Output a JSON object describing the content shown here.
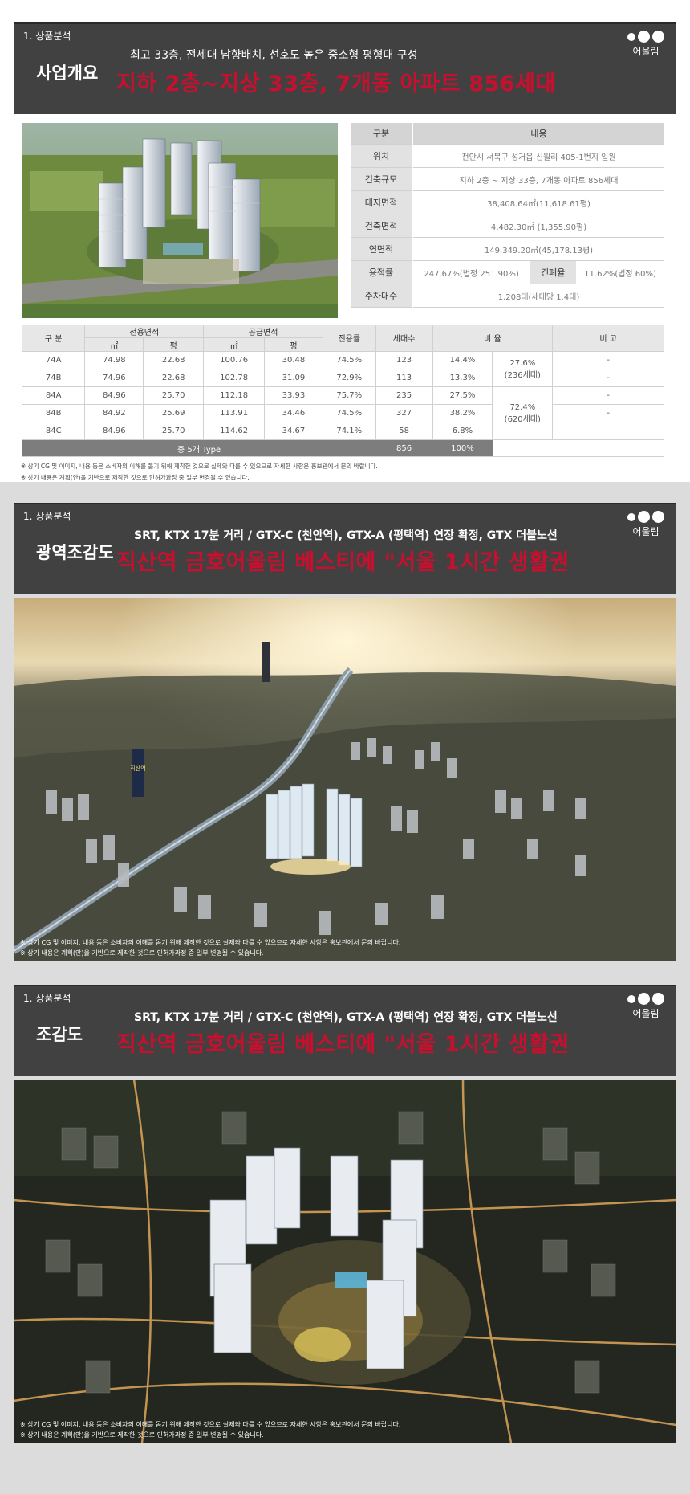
{
  "logo": {
    "label": "어울림"
  },
  "section1": {
    "crumb": "1. 상품분석",
    "title": "사업개요",
    "subtitle": "최고 33층, 전세대 남향배치, 선호도 높은 중소형 평형대 구성",
    "headline": "지하 2층~지상 33층, 7개동 아파트 856세대",
    "spec": {
      "head_key": "구분",
      "head_val": "내용",
      "rows": [
        {
          "k": "위치",
          "v": "천안시 서북구 성거읍 신월리 405-1번지 일원"
        },
        {
          "k": "건축규모",
          "v": "지하 2층 ~ 지상 33층, 7개동 아파트 856세대"
        },
        {
          "k": "대지면적",
          "v": "38,408.64㎡(11,618.61평)"
        },
        {
          "k": "건축면적",
          "v": "4,482.30㎡ (1,355.90평)"
        },
        {
          "k": "연면적",
          "v": "149,349.20㎡(45,178.13평)"
        }
      ],
      "far_key": "용적률",
      "far_val": "247.67%(법정 251.90%)",
      "bcr_key": "건폐율",
      "bcr_val": "11.62%(법정 60%)",
      "parking_key": "주차대수",
      "parking_val": "1,208대(세대당 1.4대)"
    },
    "units": {
      "h_type": "구 분",
      "h_exclusive": "전용면적",
      "h_supply": "공급면적",
      "h_m2": "㎡",
      "h_py": "평",
      "h_rate": "전용률",
      "h_households": "세대수",
      "h_ratio": "비 율",
      "h_note": "비 고",
      "rows": [
        {
          "type": "74A",
          "em2": "74.98",
          "epy": "22.68",
          "sm2": "100.76",
          "spy": "30.48",
          "rate": "74.5%",
          "hh": "123",
          "ratio": "14.4%",
          "note": "-"
        },
        {
          "type": "74B",
          "em2": "74.96",
          "epy": "22.68",
          "sm2": "102.78",
          "spy": "31.09",
          "rate": "72.9%",
          "hh": "113",
          "ratio": "13.3%",
          "note": "-"
        },
        {
          "type": "84A",
          "em2": "84.96",
          "epy": "25.70",
          "sm2": "112.18",
          "spy": "33.93",
          "rate": "75.7%",
          "hh": "235",
          "ratio": "27.5%",
          "note": "-"
        },
        {
          "type": "84B",
          "em2": "84.92",
          "epy": "25.69",
          "sm2": "113.91",
          "spy": "34.46",
          "rate": "74.5%",
          "hh": "327",
          "ratio": "38.2%",
          "note": "-"
        },
        {
          "type": "84C",
          "em2": "84.96",
          "epy": "25.70",
          "sm2": "114.62",
          "spy": "34.67",
          "rate": "74.1%",
          "hh": "58",
          "ratio": "6.8%",
          "note": ""
        }
      ],
      "group1_pct": "27.6%",
      "group1_hh": "(236세대)",
      "group2_pct": "72.4%",
      "group2_hh": "(620세대)",
      "total_label": "총 5개 Type",
      "total_hh": "856",
      "total_ratio": "100%"
    },
    "note1": "※ 상기 CG 및 이미지, 내용 등은 소비자의 이해를 돕기 위해 제작한 것으로 실제와 다를 수 있으므로 자세한 사항은 홍보관에서 문의 바랍니다.",
    "note2": "※ 상기 내용은 계획(안)을 기반으로 제작한 것으로 인허가과정 중 일부 변경될 수 있습니다."
  },
  "section2": {
    "crumb": "1. 상품분석",
    "title": "광역조감도",
    "subtitle": "SRT, KTX 17분 거리 / GTX-C (천안역), GTX-A (평택역) 연장 확정, GTX 더블노선",
    "headline": "직산역 금호어울림 베스티에 \"서울 1시간 생활권",
    "sign_text": "직산역",
    "note1": "※ 상기 CG 및 이미지, 내용 등은 소비자의 이해를 돕기 위해 제작한 것으로 실제와 다를 수 있으므로 자세한 사항은 홍보관에서 문의 바랍니다.",
    "note2": "※ 상기 내용은 계획(안)을 기반으로 제작한 것으로 인허가과정 중 일부 변경될 수 있습니다."
  },
  "section3": {
    "crumb": "1. 상품분석",
    "title": "조감도",
    "subtitle": "SRT, KTX 17분 거리 / GTX-C (천안역), GTX-A (평택역) 연장 확정, GTX 더블노선",
    "headline": "직산역 금호어울림 베스티에 \"서울 1시간 생활권",
    "note1": "※ 상기 CG 및 이미지, 내용 등은 소비자의 이해를 돕기 위해 제작한 것으로 실제와 다를 수 있으므로 자세한 사항은 홍보관에서 문의 바랍니다.",
    "note2": "※ 상기 내용은 계획(안)을 기반으로 제작한 것으로 인허가과정 중 일부 변경될 수 있습니다."
  }
}
